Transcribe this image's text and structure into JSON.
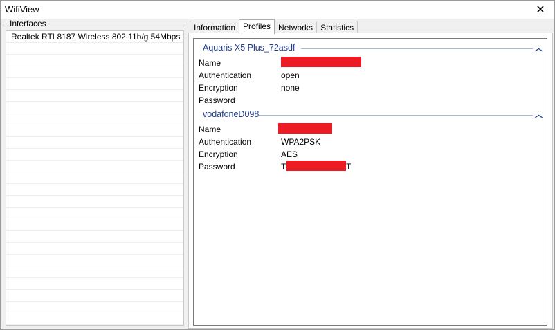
{
  "window": {
    "title": "WifiView",
    "close_glyph": "✕"
  },
  "interfaces": {
    "legend": "Interfaces",
    "items": [
      {
        "label": "Realtek RTL8187 Wireless 802.11b/g 54Mbps U..."
      }
    ],
    "empty_rows": 24
  },
  "tabs": [
    {
      "label": "Information",
      "active": false
    },
    {
      "label": "Profiles",
      "active": true
    },
    {
      "label": "Networks",
      "active": false
    },
    {
      "label": "Statistics",
      "active": false
    }
  ],
  "profiles": [
    {
      "name": "Aquaris X5 Plus_72asdf",
      "collapse_icon": "chevron-up-icon",
      "properties": [
        {
          "label": "Name",
          "value": "",
          "redacted": true
        },
        {
          "label": "Authentication",
          "value": "open"
        },
        {
          "label": "Encryption",
          "value": "none"
        },
        {
          "label": "Password",
          "value": ""
        }
      ]
    },
    {
      "name": "vodafoneD098",
      "collapse_icon": "chevron-up-icon",
      "properties": [
        {
          "label": "Name",
          "value": "",
          "redacted": true
        },
        {
          "label": "Authentication",
          "value": "WPA2PSK"
        },
        {
          "label": "Encryption",
          "value": "AES"
        },
        {
          "label": "Password",
          "value_prefix": "T",
          "value_suffix": "T",
          "redacted": true
        }
      ]
    }
  ],
  "colors": {
    "redaction": "#ed1c24",
    "group_title": "#1e3a8a"
  }
}
